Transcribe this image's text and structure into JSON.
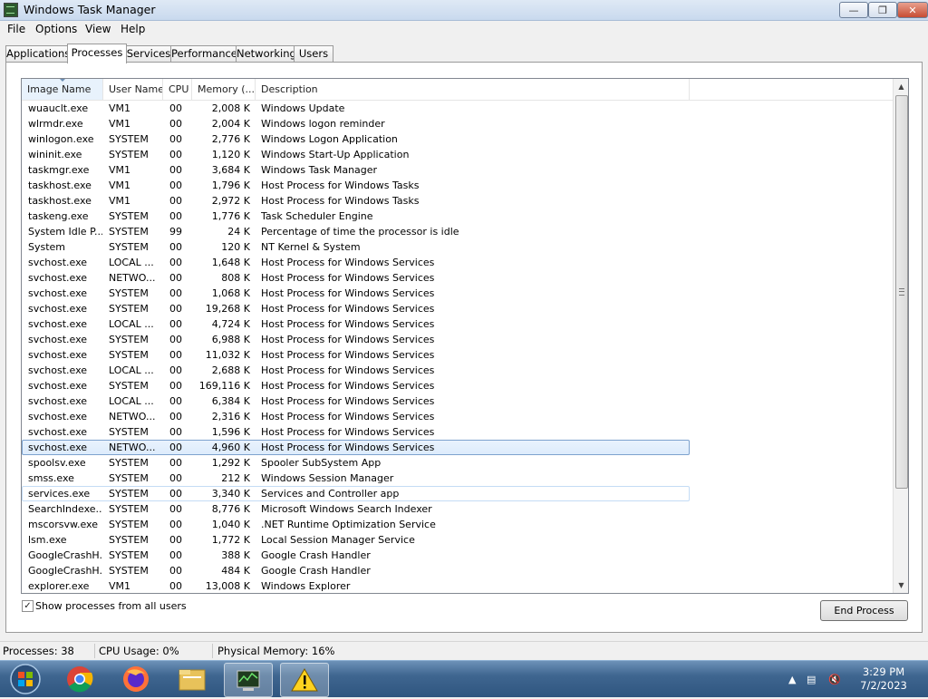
{
  "window": {
    "title": "Windows Task Manager"
  },
  "menu": {
    "items": [
      "File",
      "Options",
      "View",
      "Help"
    ]
  },
  "tabs": [
    "Applications",
    "Processes",
    "Services",
    "Performance",
    "Networking",
    "Users"
  ],
  "active_tab": "Processes",
  "columns": {
    "name": "Image Name",
    "user": "User Name",
    "cpu": "CPU",
    "memory": "Memory (...",
    "description": "Description"
  },
  "processes": [
    {
      "name": "wuauclt.exe",
      "user": "VM1",
      "cpu": "00",
      "memory": "2,008 K",
      "description": "Windows Update"
    },
    {
      "name": "wlrmdr.exe",
      "user": "VM1",
      "cpu": "00",
      "memory": "2,004 K",
      "description": "Windows logon reminder"
    },
    {
      "name": "winlogon.exe",
      "user": "SYSTEM",
      "cpu": "00",
      "memory": "2,776 K",
      "description": "Windows Logon Application"
    },
    {
      "name": "wininit.exe",
      "user": "SYSTEM",
      "cpu": "00",
      "memory": "1,120 K",
      "description": "Windows Start-Up Application"
    },
    {
      "name": "taskmgr.exe",
      "user": "VM1",
      "cpu": "00",
      "memory": "3,684 K",
      "description": "Windows Task Manager"
    },
    {
      "name": "taskhost.exe",
      "user": "VM1",
      "cpu": "00",
      "memory": "1,796 K",
      "description": "Host Process for Windows Tasks"
    },
    {
      "name": "taskhost.exe",
      "user": "VM1",
      "cpu": "00",
      "memory": "2,972 K",
      "description": "Host Process for Windows Tasks"
    },
    {
      "name": "taskeng.exe",
      "user": "SYSTEM",
      "cpu": "00",
      "memory": "1,776 K",
      "description": "Task Scheduler Engine"
    },
    {
      "name": "System Idle P...",
      "user": "SYSTEM",
      "cpu": "99",
      "memory": "24 K",
      "description": "Percentage of time the processor is idle"
    },
    {
      "name": "System",
      "user": "SYSTEM",
      "cpu": "00",
      "memory": "120 K",
      "description": "NT Kernel & System"
    },
    {
      "name": "svchost.exe",
      "user": "LOCAL ...",
      "cpu": "00",
      "memory": "1,648 K",
      "description": "Host Process for Windows Services"
    },
    {
      "name": "svchost.exe",
      "user": "NETWO...",
      "cpu": "00",
      "memory": "808 K",
      "description": "Host Process for Windows Services"
    },
    {
      "name": "svchost.exe",
      "user": "SYSTEM",
      "cpu": "00",
      "memory": "1,068 K",
      "description": "Host Process for Windows Services"
    },
    {
      "name": "svchost.exe",
      "user": "SYSTEM",
      "cpu": "00",
      "memory": "19,268 K",
      "description": "Host Process for Windows Services"
    },
    {
      "name": "svchost.exe",
      "user": "LOCAL ...",
      "cpu": "00",
      "memory": "4,724 K",
      "description": "Host Process for Windows Services"
    },
    {
      "name": "svchost.exe",
      "user": "SYSTEM",
      "cpu": "00",
      "memory": "6,988 K",
      "description": "Host Process for Windows Services"
    },
    {
      "name": "svchost.exe",
      "user": "SYSTEM",
      "cpu": "00",
      "memory": "11,032 K",
      "description": "Host Process for Windows Services"
    },
    {
      "name": "svchost.exe",
      "user": "LOCAL ...",
      "cpu": "00",
      "memory": "2,688 K",
      "description": "Host Process for Windows Services"
    },
    {
      "name": "svchost.exe",
      "user": "SYSTEM",
      "cpu": "00",
      "memory": "169,116 K",
      "description": "Host Process for Windows Services"
    },
    {
      "name": "svchost.exe",
      "user": "LOCAL ...",
      "cpu": "00",
      "memory": "6,384 K",
      "description": "Host Process for Windows Services"
    },
    {
      "name": "svchost.exe",
      "user": "NETWO...",
      "cpu": "00",
      "memory": "2,316 K",
      "description": "Host Process for Windows Services"
    },
    {
      "name": "svchost.exe",
      "user": "SYSTEM",
      "cpu": "00",
      "memory": "1,596 K",
      "description": "Host Process for Windows Services"
    },
    {
      "name": "svchost.exe",
      "user": "NETWO...",
      "cpu": "00",
      "memory": "4,960 K",
      "description": "Host Process for Windows Services"
    },
    {
      "name": "spoolsv.exe",
      "user": "SYSTEM",
      "cpu": "00",
      "memory": "1,292 K",
      "description": "Spooler SubSystem App"
    },
    {
      "name": "smss.exe",
      "user": "SYSTEM",
      "cpu": "00",
      "memory": "212 K",
      "description": "Windows Session Manager"
    },
    {
      "name": "services.exe",
      "user": "SYSTEM",
      "cpu": "00",
      "memory": "3,340 K",
      "description": "Services and Controller app"
    },
    {
      "name": "SearchIndexe...",
      "user": "SYSTEM",
      "cpu": "00",
      "memory": "8,776 K",
      "description": "Microsoft Windows Search Indexer"
    },
    {
      "name": "mscorsvw.exe",
      "user": "SYSTEM",
      "cpu": "00",
      "memory": "1,040 K",
      "description": ".NET Runtime Optimization Service"
    },
    {
      "name": "lsm.exe",
      "user": "SYSTEM",
      "cpu": "00",
      "memory": "1,772 K",
      "description": "Local Session Manager Service"
    },
    {
      "name": "GoogleCrashH...",
      "user": "SYSTEM",
      "cpu": "00",
      "memory": "388 K",
      "description": "Google Crash Handler"
    },
    {
      "name": "GoogleCrashH...",
      "user": "SYSTEM",
      "cpu": "00",
      "memory": "484 K",
      "description": "Google Crash Handler"
    },
    {
      "name": "explorer.exe",
      "user": "VM1",
      "cpu": "00",
      "memory": "13,008 K",
      "description": "Windows Explorer"
    }
  ],
  "selected_row_index": 22,
  "hover_row_index": 25,
  "show_all_users": {
    "label": "Show processes from all users",
    "checked": true
  },
  "end_process_label": "End Process",
  "status": {
    "processes": "Processes: 38",
    "cpu": "CPU Usage: 0%",
    "memory": "Physical Memory: 16%"
  },
  "taskbar": {
    "icons": [
      "start-orb-icon",
      "chrome-icon",
      "firefox-icon",
      "file-explorer-icon",
      "task-manager-icon",
      "warning-icon"
    ],
    "time": "3:29 PM",
    "date": "7/2/2023"
  },
  "colors": {
    "selection": "#dcebfc",
    "selection_border": "#7da2ce",
    "taskbar": "#3f6690"
  }
}
